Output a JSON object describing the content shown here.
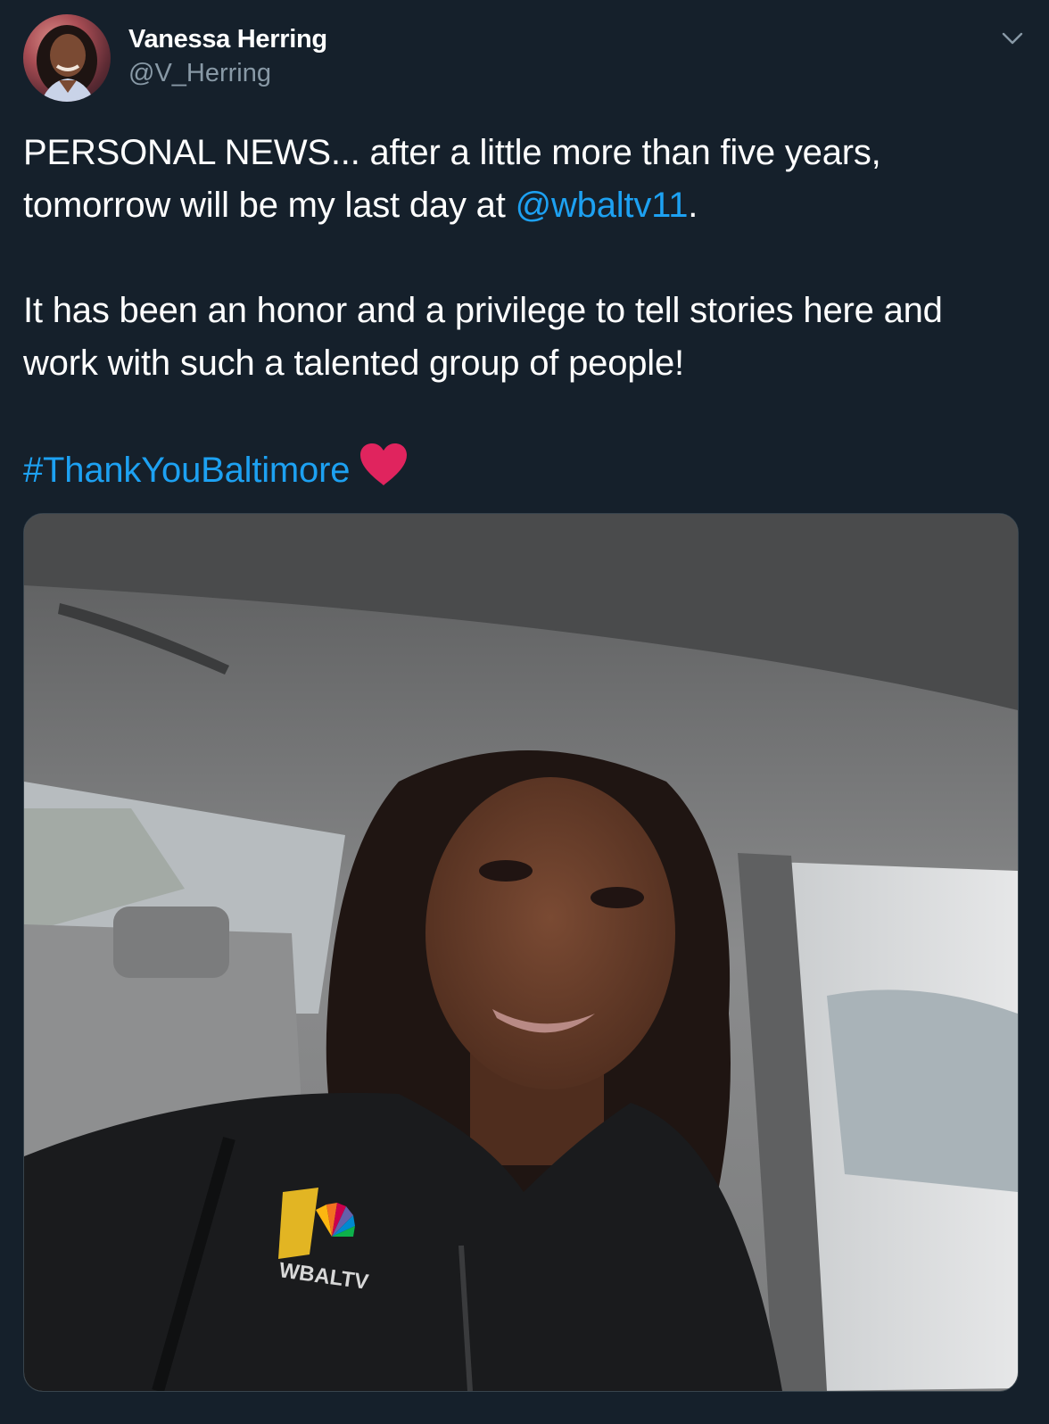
{
  "tweet": {
    "author": {
      "display_name": "Vanessa Herring",
      "handle": "@V_Herring"
    },
    "text": {
      "line1_part1": "PERSONAL NEWS... after a little more than five years, tomorrow will be my last day at ",
      "mention": "@wbaltv11",
      "line1_part2": ".",
      "paragraph2": "It has been an honor and a privilege to tell stories here and work with such a talented group of people!",
      "hashtag": "#ThankYouBaltimore"
    },
    "media": {
      "logo_text": "WBALTV"
    }
  },
  "colors": {
    "background": "#15202b",
    "text": "#ffffff",
    "secondary_text": "#8899a6",
    "link": "#1da1f2",
    "heart": "#e0245e"
  },
  "icons": {
    "caret": "chevron-down-icon",
    "heart": "red-heart-emoji"
  }
}
